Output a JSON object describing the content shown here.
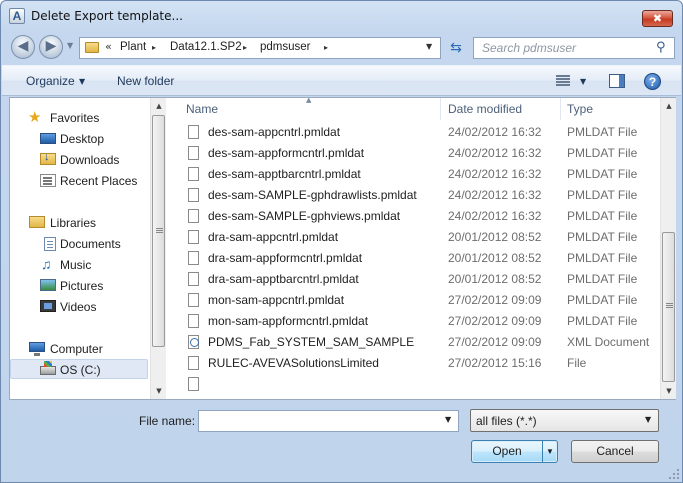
{
  "window": {
    "title": "Delete Export template...",
    "app_icon_letter": "A",
    "close_glyph": "✖"
  },
  "address": {
    "overflow_chevron": "«",
    "parts": [
      "Plant",
      "Data12.1.SP2",
      "pdmsuser"
    ],
    "separator": "▸"
  },
  "search": {
    "placeholder": "Search pdmsuser"
  },
  "toolbar": {
    "organize_label": "Organize",
    "new_folder_label": "New folder",
    "help_glyph": "?"
  },
  "sidebar": {
    "favorites_label": "Favorites",
    "favorites": [
      "Desktop",
      "Downloads",
      "Recent Places"
    ],
    "libraries_label": "Libraries",
    "libraries": [
      "Documents",
      "Music",
      "Pictures",
      "Videos"
    ],
    "computer_label": "Computer",
    "drives": [
      "OS (C:)"
    ],
    "selected": "OS (C:)"
  },
  "columns": [
    "Name",
    "Date modified",
    "Type"
  ],
  "files": [
    {
      "name": "des-sam-appcntrl.pmldat",
      "date": "24/02/2012 16:32",
      "type": "PMLDAT File",
      "icon": "file-icon"
    },
    {
      "name": "des-sam-appformcntrl.pmldat",
      "date": "24/02/2012 16:32",
      "type": "PMLDAT File",
      "icon": "file-icon"
    },
    {
      "name": "des-sam-apptbarcntrl.pmldat",
      "date": "24/02/2012 16:32",
      "type": "PMLDAT File",
      "icon": "file-icon"
    },
    {
      "name": "des-sam-SAMPLE-gphdrawlists.pmldat",
      "date": "24/02/2012 16:32",
      "type": "PMLDAT File",
      "icon": "file-icon"
    },
    {
      "name": "des-sam-SAMPLE-gphviews.pmldat",
      "date": "24/02/2012 16:32",
      "type": "PMLDAT File",
      "icon": "file-icon"
    },
    {
      "name": "dra-sam-appcntrl.pmldat",
      "date": "20/01/2012 08:52",
      "type": "PMLDAT File",
      "icon": "file-icon"
    },
    {
      "name": "dra-sam-appformcntrl.pmldat",
      "date": "20/01/2012 08:52",
      "type": "PMLDAT File",
      "icon": "file-icon"
    },
    {
      "name": "dra-sam-apptbarcntrl.pmldat",
      "date": "20/01/2012 08:52",
      "type": "PMLDAT File",
      "icon": "file-icon"
    },
    {
      "name": "mon-sam-appcntrl.pmldat",
      "date": "27/02/2012 09:09",
      "type": "PMLDAT File",
      "icon": "file-icon"
    },
    {
      "name": "mon-sam-appformcntrl.pmldat",
      "date": "27/02/2012 09:09",
      "type": "PMLDAT File",
      "icon": "file-icon"
    },
    {
      "name": "PDMS_Fab_SYSTEM_SAM_SAMPLE",
      "date": "27/02/2012 09:09",
      "type": "XML Document",
      "icon": "xml-file-icon"
    },
    {
      "name": "RULEC-AVEVASolutionsLimited",
      "date": "27/02/2012 15:16",
      "type": "File",
      "icon": "file-icon"
    },
    {
      "name": "",
      "date": "",
      "type": "",
      "icon": "file-icon"
    }
  ],
  "filename": {
    "label": "File name:",
    "value": ""
  },
  "filter": {
    "selected": "all files (*.*)"
  },
  "buttons": {
    "open": "Open",
    "cancel": "Cancel"
  }
}
